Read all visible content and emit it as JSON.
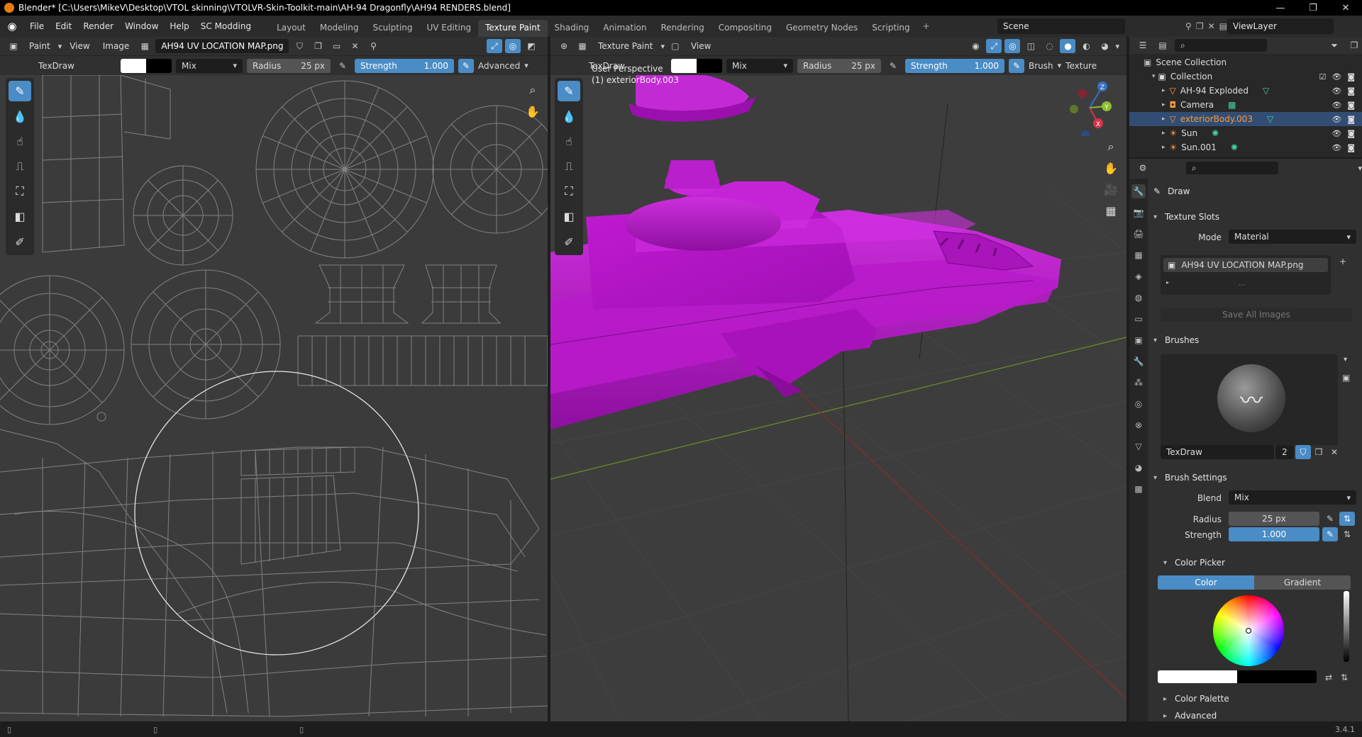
{
  "window": {
    "title": "Blender* [C:\\Users\\MikeV\\Desktop\\VTOL skinning\\VTOLVR-Skin-Toolkit-main\\AH-94 Dragonfly\\AH94 RENDERS.blend]",
    "controls": [
      "—",
      "❐",
      "✕"
    ]
  },
  "menu": [
    "File",
    "Edit",
    "Render",
    "Window",
    "Help",
    "SC Modding"
  ],
  "workspaces": [
    "Layout",
    "Modeling",
    "Sculpting",
    "UV Editing",
    "Texture Paint",
    "Shading",
    "Animation",
    "Rendering",
    "Compositing",
    "Geometry Nodes",
    "Scripting"
  ],
  "active_workspace": "Texture Paint",
  "scene": "Scene",
  "view_layer": "ViewLayer",
  "image_editor": {
    "mode": "Paint",
    "menus": [
      "View",
      "Image"
    ],
    "image_name": "AH94 UV LOCATION MAP.png",
    "brush": "TexDraw",
    "blend": "Mix",
    "radius_label": "Radius",
    "radius_value": "25 px",
    "strength_label": "Strength",
    "strength_value": "1.000",
    "advanced": "Advanced"
  },
  "viewport": {
    "mode": "Texture Paint",
    "menu": "View",
    "brush": "TexDraw",
    "blend": "Mix",
    "radius_label": "Radius",
    "radius_value": "25 px",
    "strength_label": "Strength",
    "strength_value": "1.000",
    "brush_menu": "Brush",
    "texture_menu": "Texture",
    "overlay_line1": "User Perspective",
    "overlay_line2": "(1) exteriorBody.003",
    "gizmo_axes": [
      "Z",
      "Y",
      "X"
    ]
  },
  "outliner": {
    "root": "Scene Collection",
    "collection": "Collection",
    "items": [
      {
        "name": "AH-94 Exploded",
        "selected": false
      },
      {
        "name": "Camera",
        "selected": false
      },
      {
        "name": "exteriorBody.003",
        "selected": true
      },
      {
        "name": "Sun",
        "selected": false
      },
      {
        "name": "Sun.001",
        "selected": false
      }
    ]
  },
  "properties": {
    "tool_name": "Draw",
    "texture_slots": {
      "header": "Texture Slots",
      "mode_label": "Mode",
      "mode_value": "Material",
      "slot": "AH94 UV LOCATION MAP.png",
      "save_all": "Save All Images"
    },
    "brushes": {
      "header": "Brushes",
      "brush_name": "TexDraw",
      "users": "2"
    },
    "brush_settings": {
      "header": "Brush Settings",
      "blend_label": "Blend",
      "blend_value": "Mix",
      "radius_label": "Radius",
      "radius_value": "25 px",
      "strength_label": "Strength",
      "strength_value": "1.000"
    },
    "color_picker": {
      "header": "Color Picker",
      "tab_color": "Color",
      "tab_gradient": "Gradient"
    },
    "color_palette": "Color Palette",
    "advanced": "Advanced"
  },
  "status": {
    "version": "3.4.1"
  },
  "colors": {
    "accent": "#4a8cc5",
    "active_tool": "#4a8cc5",
    "model_magenta": "#b214c4",
    "selection": "#324d74",
    "selected_text": "#ff9a35"
  }
}
